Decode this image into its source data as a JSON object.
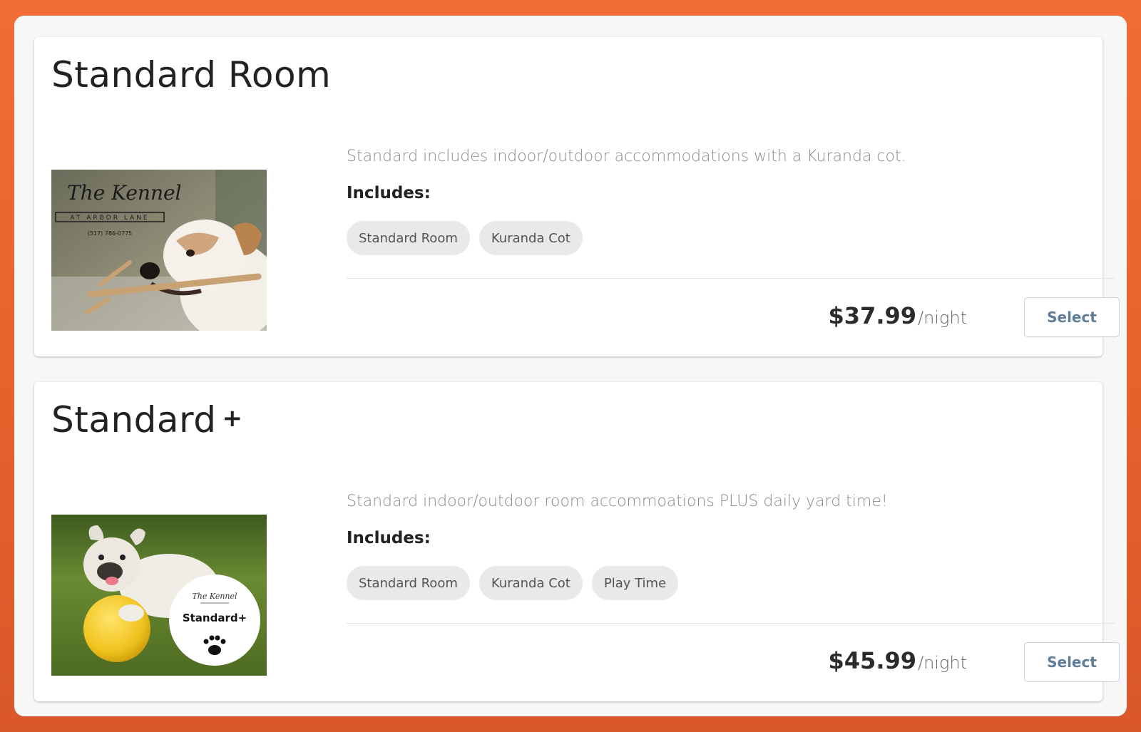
{
  "rooms": [
    {
      "title": "Standard Room",
      "title_suffix": "",
      "description": "Standard includes indoor/outdoor accommodations with a Kuranda cot.",
      "includes_label": "Includes:",
      "features": [
        "Standard Room",
        "Kuranda Cot"
      ],
      "price": "$37.99",
      "price_unit": "/night",
      "select_label": "Select",
      "image": {
        "logo_script": "The Kennel",
        "logo_sub": "AT ARBOR LANE",
        "logo_phone": "(517) 786-0775"
      }
    },
    {
      "title": "Standard",
      "title_suffix": "+",
      "description": "Standard indoor/outdoor room accommoations PLUS daily yard time!",
      "includes_label": "Includes:",
      "features": [
        "Standard Room",
        "Kuranda Cot",
        "Play Time"
      ],
      "price": "$45.99",
      "price_unit": "/night",
      "select_label": "Select",
      "image": {
        "badge_logo": "The Kennel",
        "badge_text": "Standard+"
      }
    }
  ],
  "colors": {
    "background_orange": "#f26d36",
    "accent_button_text": "#5f7d99",
    "chip_bg": "#e9e9e9"
  }
}
